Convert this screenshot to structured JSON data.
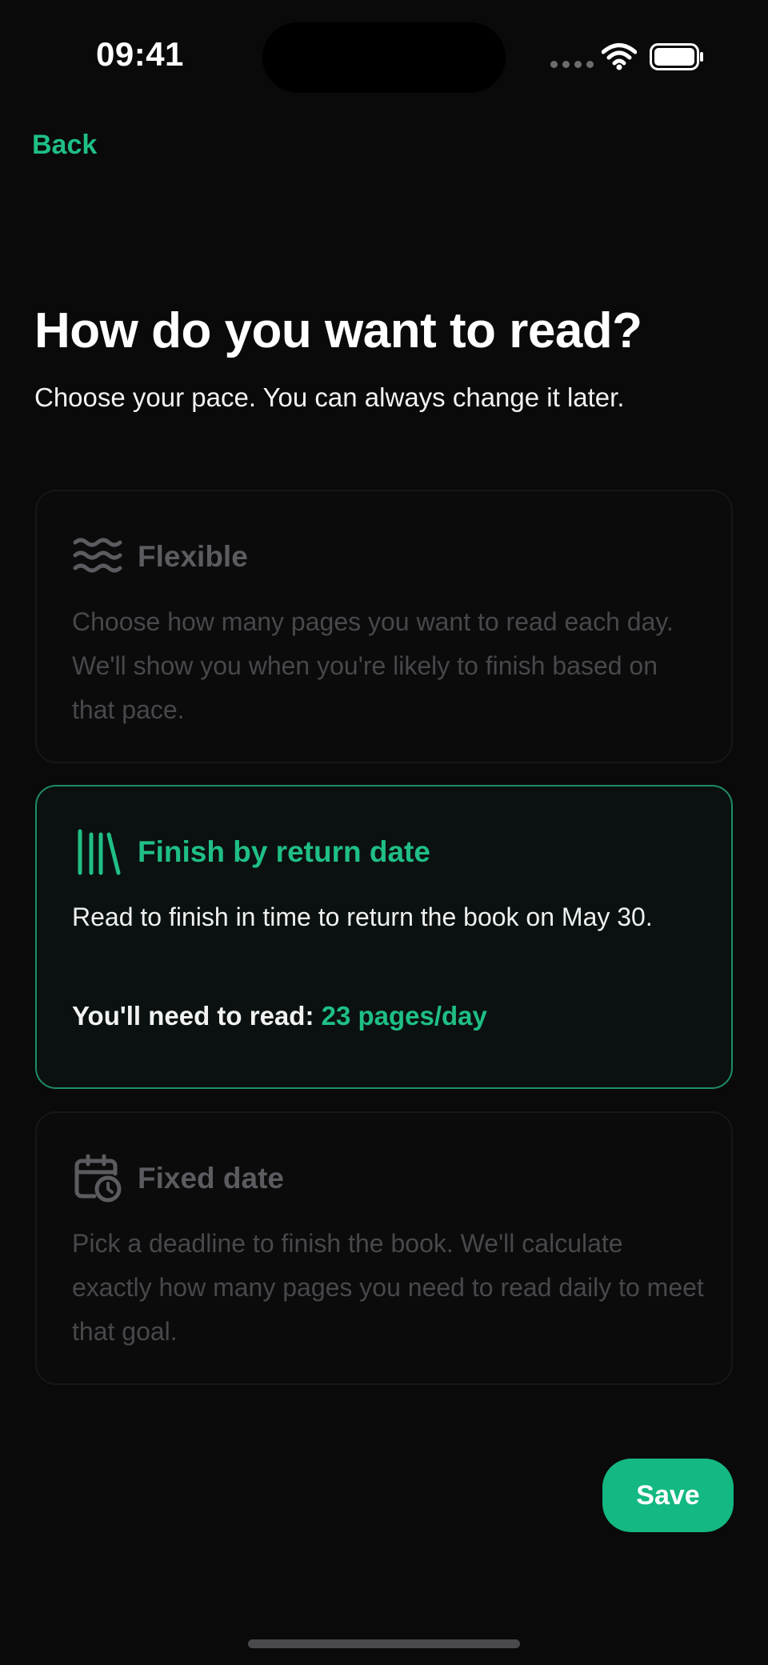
{
  "status_bar": {
    "time": "09:41",
    "wifi_icon": "wifi-icon",
    "battery_icon": "battery-full-icon"
  },
  "nav": {
    "back_label": "Back"
  },
  "header": {
    "title": "How do you want to read?",
    "subtitle": "Choose your pace. You can always change it later."
  },
  "options": [
    {
      "id": "flexible",
      "icon": "waves-icon",
      "title": "Flexible",
      "description": "Choose how many pages you want to read each day. We'll show you when you're likely to finish based on that pace.",
      "selected": false
    },
    {
      "id": "return-date",
      "icon": "books-icon",
      "title": "Finish by return date",
      "description": "Read to finish in time to return the book on May 30.",
      "pace_label": "You'll need to read:",
      "pace_value": "23 pages/day",
      "selected": true
    },
    {
      "id": "fixed-date",
      "icon": "calendar-clock-icon",
      "title": "Fixed date",
      "description": "Pick a deadline to finish the book. We'll calculate exactly how many pages you need to read daily to meet that goal.",
      "selected": false
    }
  ],
  "footer": {
    "save_label": "Save"
  },
  "colors": {
    "background": "#0a0a0b",
    "accent": "#1fbf85",
    "save_button": "#14b882",
    "inactive_text": "#5b5b60"
  }
}
